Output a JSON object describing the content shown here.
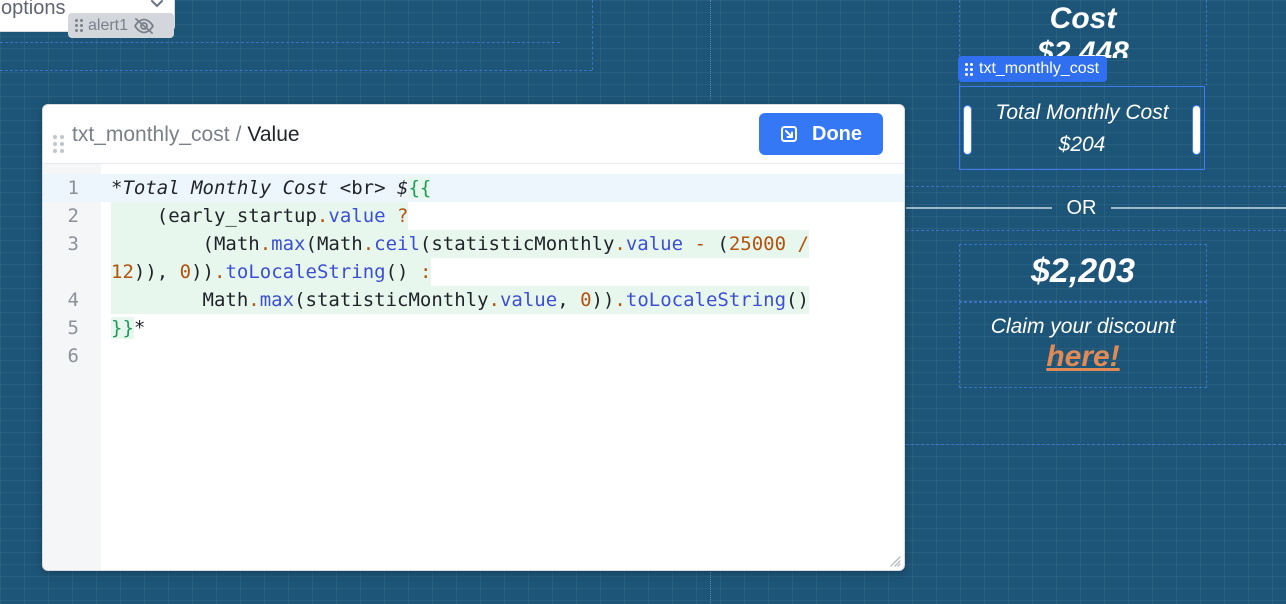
{
  "canvas": {
    "options_select": {
      "text": "options"
    },
    "alert_tag": {
      "label": "alert1"
    }
  },
  "preview": {
    "heading_title": "Cost",
    "heading_prev_amount": "$2,448",
    "component_tag": {
      "label": "txt_monthly_cost"
    },
    "monthly_cost": {
      "line1": "Total Monthly Cost",
      "line2": "$204"
    },
    "or_text": "OR",
    "price": "$2,203",
    "claim_text": "Claim your discount",
    "claim_link": "here!"
  },
  "editor": {
    "breadcrumb": {
      "component": "txt_monthly_cost",
      "separator": "/",
      "field": "Value"
    },
    "done_label": "Done",
    "line_numbers": [
      "1",
      "2",
      "3",
      "",
      "4",
      "5",
      "6"
    ],
    "code": {
      "l1_text1": "*Total Monthly Cost ",
      "l1_tag": "<br>",
      "l1_text2": " $",
      "l1_brace": "{{",
      "l2_indent": "    ",
      "l2_var": "(early_startup",
      "l2_dot": ".",
      "l2_prop": "value",
      "l2_op": " ?",
      "l3_indent": "        ",
      "l3_a": "(Math",
      "l3_dot1": ".",
      "l3_max": "max",
      "l3_b": "(Math",
      "l3_dot2": ".",
      "l3_ceil": "ceil",
      "l3_c": "(statisticMonthly",
      "l3_dot3": ".",
      "l3_value": "value",
      "l3_minus": " - ",
      "l3_paren": "(",
      "l3_num": "25000",
      "l3_div": " /",
      "l3w_num": "12",
      "l3w_a": ")), ",
      "l3w_zero": "0",
      "l3w_b": "))",
      "l3w_dot": ".",
      "l3w_fn": "toLocaleString",
      "l3w_c": "() ",
      "l3w_colon": ":",
      "l4_indent": "        ",
      "l4_a": "Math",
      "l4_dot1": ".",
      "l4_max": "max",
      "l4_b": "(statisticMonthly",
      "l4_dot2": ".",
      "l4_value": "value",
      "l4_c": ", ",
      "l4_zero": "0",
      "l4_d": "))",
      "l4_dot3": ".",
      "l4_fn": "toLocaleString",
      "l4_e": "()",
      "l5_brace": "}}",
      "l5_star": "*"
    }
  },
  "colors": {
    "canvas_bg": "#1d5578",
    "accent": "#3478f6",
    "selection": "#3d7bf0",
    "link": "#e08a55"
  }
}
